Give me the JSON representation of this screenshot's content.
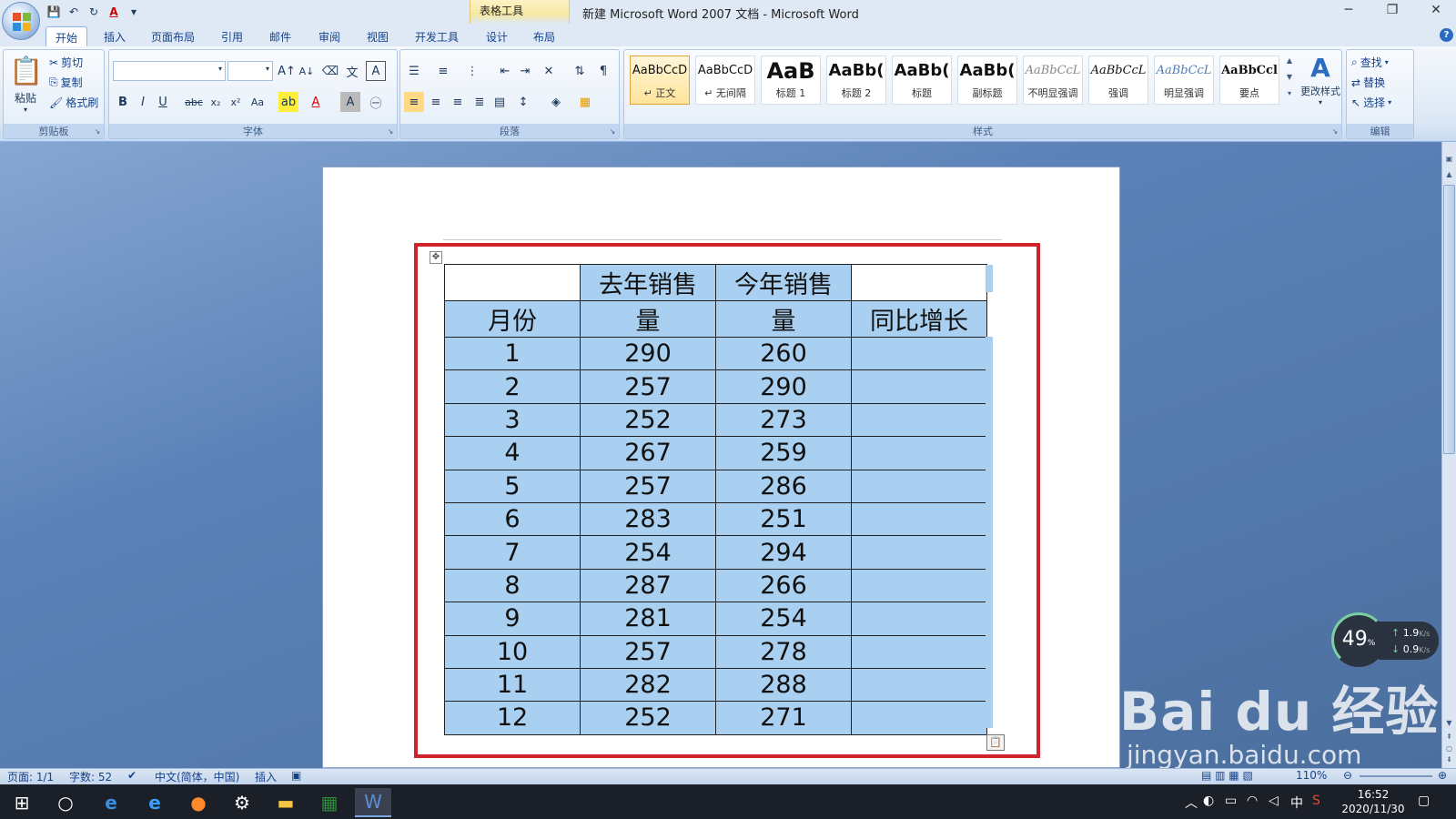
{
  "window": {
    "title": "新建 Microsoft Word 2007 文档 - Microsoft Word",
    "context_tab": "表格工具"
  },
  "qat": {
    "items": [
      "save-icon",
      "undo-icon",
      "redo-icon",
      "font-color-icon",
      "customize-icon"
    ]
  },
  "tabs": [
    "开始",
    "插入",
    "页面布局",
    "引用",
    "邮件",
    "审阅",
    "视图",
    "开发工具",
    "设计",
    "布局"
  ],
  "ribbon": {
    "clipboard": {
      "label": "剪贴板",
      "paste": "粘贴",
      "cut": "剪切",
      "copy": "复制",
      "format_painter": "格式刷"
    },
    "font": {
      "label": "字体",
      "font_name": "",
      "font_size": ""
    },
    "paragraph": {
      "label": "段落"
    },
    "styles": {
      "label": "样式",
      "items": [
        {
          "sample": "AaBbCcD",
          "name": "↵ 正文"
        },
        {
          "sample": "AaBbCcD",
          "name": "↵ 无间隔"
        },
        {
          "sample": "AaB",
          "name": "标题 1"
        },
        {
          "sample": "AaBb(",
          "name": "标题 2"
        },
        {
          "sample": "AaBb(",
          "name": "标题"
        },
        {
          "sample": "AaBb(",
          "name": "副标题"
        },
        {
          "sample": "AaBbCcL",
          "name": "不明显强调"
        },
        {
          "sample": "AaBbCcL",
          "name": "强调"
        },
        {
          "sample": "AaBbCcL",
          "name": "明显强调"
        },
        {
          "sample": "AaBbCcl",
          "name": "要点"
        }
      ],
      "change_styles": "更改样式"
    },
    "editing": {
      "label": "编辑",
      "find": "查找",
      "replace": "替换",
      "select": "选择"
    }
  },
  "table": {
    "headers_top": [
      "",
      "去年销售",
      "今年销售",
      ""
    ],
    "headers_bottom": [
      "月份",
      "量",
      "量",
      "同比增长"
    ],
    "rows": [
      [
        "1",
        "290",
        "260",
        ""
      ],
      [
        "2",
        "257",
        "290",
        ""
      ],
      [
        "3",
        "252",
        "273",
        ""
      ],
      [
        "4",
        "267",
        "259",
        ""
      ],
      [
        "5",
        "257",
        "286",
        ""
      ],
      [
        "6",
        "283",
        "251",
        ""
      ],
      [
        "7",
        "254",
        "294",
        ""
      ],
      [
        "8",
        "287",
        "266",
        ""
      ],
      [
        "9",
        "281",
        "254",
        ""
      ],
      [
        "10",
        "257",
        "278",
        ""
      ],
      [
        "11",
        "282",
        "288",
        ""
      ],
      [
        "12",
        "252",
        "271",
        ""
      ]
    ]
  },
  "speed_widget": {
    "percent": "49",
    "percent_unit": "%",
    "up": "1.9",
    "down": "0.9",
    "unit": "K/s"
  },
  "watermark": {
    "big": "Bai du 经验",
    "small": "jingyan.baidu.com"
  },
  "statusbar": {
    "page": "页面: 1/1",
    "words": "字数: 52",
    "language": "中文(简体，中国)",
    "mode": "插入",
    "zoom": "110%"
  },
  "taskbar": {
    "time": "16:52",
    "date": "2020/11/30",
    "ime": "中"
  },
  "colors": {
    "table_fill": "#a9d0f0",
    "red_frame": "#d3232a",
    "ribbon": "#dbe7f5"
  }
}
